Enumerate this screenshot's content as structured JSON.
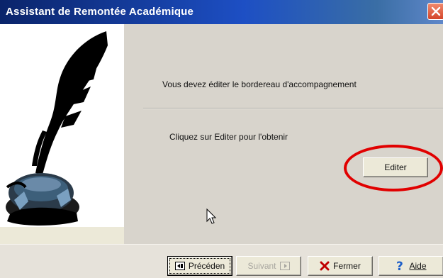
{
  "window": {
    "title": "Assistant de Remontée Académique"
  },
  "content": {
    "message_edit": "Vous devez éditer le bordereau d'accompagnement",
    "message_click": "Cliquez sur Editer pour l'obtenir",
    "edit_button": "Editer"
  },
  "footer": {
    "prev_label": "Précéden",
    "next_label": "Suivant",
    "close_label": "Fermer",
    "help_label": "Aide"
  },
  "colors": {
    "titlebar": "#0a246a",
    "annotation": "#e10000"
  },
  "icons": [
    "close-icon",
    "quill-inkwell-illustration",
    "prev-icon",
    "next-icon",
    "red-x-icon",
    "help-question-icon",
    "mouse-cursor"
  ]
}
